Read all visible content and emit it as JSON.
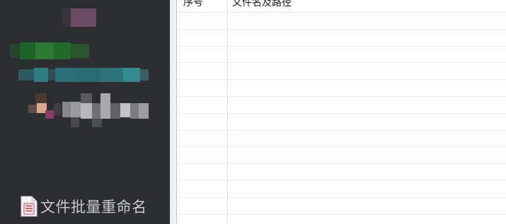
{
  "sidebar": {
    "app_name": "文件批量重命名",
    "app_icon": "document-icon",
    "profile_obscured": true
  },
  "table": {
    "columns": [
      {
        "label": "序号"
      },
      {
        "label": "文件名及路径"
      }
    ],
    "rows": []
  },
  "colors": {
    "sidebar_bg": "#2b2d31",
    "sidebar_text": "#c9cacd",
    "table_bg": "#ffffff",
    "grid_line": "#ececec"
  }
}
